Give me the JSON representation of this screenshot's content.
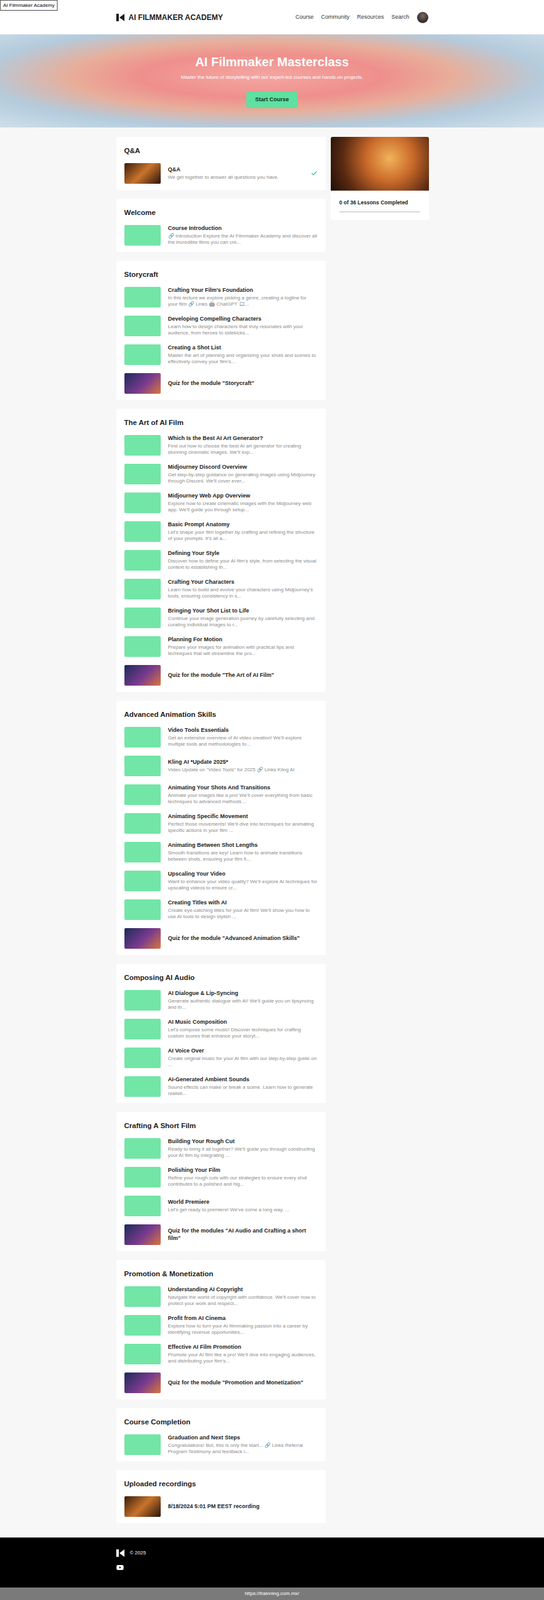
{
  "skip_link": "AI Filmmaker Academy",
  "header": {
    "brand": "AI FILMMAKER ACADEMY",
    "nav": [
      "Course",
      "Community",
      "Resources",
      "Search"
    ]
  },
  "hero": {
    "title": "AI Filmmaker Masterclass",
    "subtitle": "Master the future of storytelling with our expert-led courses and hands-on projects.",
    "button": "Start Course"
  },
  "modules": [
    {
      "title": "Q&A",
      "items": [
        {
          "title": "Q&A",
          "description": "We get together to answer all questions you have.",
          "kind": "photo",
          "checked": true
        }
      ]
    },
    {
      "title": "Welcome",
      "items": [
        {
          "title": "Course Introduction",
          "description": "🔗 Introduction Explore the AI Filmmaker Academy and discover all the incredible films you can cre...",
          "kind": "lesson",
          "checked": false
        }
      ]
    },
    {
      "title": "Storycraft",
      "items": [
        {
          "title": "Crafting Your Film's Foundation",
          "description": "In this lecture we explore picking a genre, creating a logline for your film 🔗 Links 🤖 ChatGPT 🎞...",
          "kind": "lesson",
          "checked": false
        },
        {
          "title": "Developing Compelling Characters",
          "description": "Learn how to design characters that truly resonates with your audience, from heroes to sidekicks...",
          "kind": "lesson",
          "checked": false
        },
        {
          "title": "Creating a Shot List",
          "description": "Master the art of planning and organizing your shots and scenes to effectively convey your film's...",
          "kind": "lesson",
          "checked": false
        },
        {
          "title": "Quiz for the module \"Storycraft\"",
          "description": "",
          "kind": "quiz",
          "checked": false
        }
      ]
    },
    {
      "title": "The Art of AI Film",
      "items": [
        {
          "title": "Which Is the Best AI Art Generator?",
          "description": "Find out how to choose the best AI art generator for creating stunning cinematic images. We'll exp...",
          "kind": "lesson",
          "checked": false
        },
        {
          "title": "Midjourney Discord Overview",
          "description": "Get step-by-step guidance on generating images using Midjourney through Discord. We'll cover ever...",
          "kind": "lesson",
          "checked": false
        },
        {
          "title": "Midjourney Web App Overview",
          "description": "Explore how to create cinematic images with the Midjourney web app. We'll guide you through setup...",
          "kind": "lesson",
          "checked": false
        },
        {
          "title": "Basic Prompt Anatomy",
          "description": "Let's shape your film together by crafting and refining the structure of your prompts. It's all a...",
          "kind": "lesson",
          "checked": false
        },
        {
          "title": "Defining Your Style",
          "description": "Discover how to define your AI film's style, from selecting the visual context to establishing th...",
          "kind": "lesson",
          "checked": false
        },
        {
          "title": "Crafting Your Characters",
          "description": "Learn how to build and evolve your characters using Midjourney's tools, ensuring consistency in s...",
          "kind": "lesson",
          "checked": false
        },
        {
          "title": "Bringing Your Shot List to Life",
          "description": "Continue your image generation journey by carefully selecting and curating individual images to r...",
          "kind": "lesson",
          "checked": false
        },
        {
          "title": "Planning For Motion",
          "description": "Prepare your images for animation with practical tips and techniques that will streamline the pro...",
          "kind": "lesson",
          "checked": false
        },
        {
          "title": "Quiz for the module \"The Art of AI Film\"",
          "description": "",
          "kind": "quiz",
          "checked": false
        }
      ]
    },
    {
      "title": "Advanced Animation Skills",
      "items": [
        {
          "title": "Video Tools Essentials",
          "description": "Get an extensive overview of AI video creation! We'll explore multiple tools and methodologies to...",
          "kind": "lesson",
          "checked": false
        },
        {
          "title": "Kling AI *Update 2025*",
          "description": "Video Update on \"Video Tools\" for 2025 🔗 Links Kling AI",
          "kind": "lesson",
          "checked": false
        },
        {
          "title": "Animating Your Shots And Transitions",
          "description": "Animate your images like a pro! We'll cover everything from basic techniques to advanced methods ...",
          "kind": "lesson",
          "checked": false
        },
        {
          "title": "Animating Specific Movement",
          "description": "Perfect those movements! We'll dive into techniques for animating specific actions in your film ...",
          "kind": "lesson",
          "checked": false
        },
        {
          "title": "Animating Between Shot Lengths",
          "description": "Smooth transitions are key! Learn how to animate transitions between shots, ensuring your film fl...",
          "kind": "lesson",
          "checked": false
        },
        {
          "title": "Upscaling Your Video",
          "description": "Want to enhance your video quality? We'll explore AI techniques for upscaling videos to ensure cr...",
          "kind": "lesson",
          "checked": false
        },
        {
          "title": "Creating Titles with AI",
          "description": "Create eye-catching titles for your AI film! We'll show you how to use AI tools to design stylish ...",
          "kind": "lesson",
          "checked": false
        },
        {
          "title": "Quiz for the module \"Advanced Animation Skills\"",
          "description": "",
          "kind": "quiz",
          "checked": false
        }
      ]
    },
    {
      "title": "Composing AI Audio",
      "items": [
        {
          "title": "AI Dialogue & Lip-Syncing",
          "description": "Generate authentic dialogue with AI! We'll guide you on lipsyncing and th...",
          "kind": "lesson",
          "checked": false
        },
        {
          "title": "AI Music Composition",
          "description": "Let's compose some music! Discover techniques for crafting custom scores that enhance your storyt...",
          "kind": "lesson",
          "checked": false
        },
        {
          "title": "AI Voice Over",
          "description": "Create original music for your AI film with our step-by-step guide on ...",
          "kind": "lesson",
          "checked": false
        },
        {
          "title": "AI-Generated Ambient Sounds",
          "description": "Sound effects can make or break a scene. Learn how to generate realisti...",
          "kind": "lesson",
          "checked": false
        }
      ]
    },
    {
      "title": "Crafting A Short Film",
      "items": [
        {
          "title": "Building Your Rough Cut",
          "description": "Ready to bring it all together? We'll guide you through constructing your AI film by integrating ...",
          "kind": "lesson",
          "checked": false
        },
        {
          "title": "Polishing Your Film",
          "description": "Refine your rough cuts with our strategies to ensure every shot contributes to a polished and hig...",
          "kind": "lesson",
          "checked": false
        },
        {
          "title": "World Premiere",
          "description": "Let's get ready to premiere! We've come a long way. ...",
          "kind": "lesson",
          "checked": false
        },
        {
          "title": "Quiz for the modules \"AI Audio and Crafting a short film\"",
          "description": "",
          "kind": "quiz",
          "checked": false
        }
      ]
    },
    {
      "title": "Promotion & Monetization",
      "items": [
        {
          "title": "Understanding AI Copyright",
          "description": "Navigate the world of copyright with confidence. We'll cover how to protect your work and respect...",
          "kind": "lesson",
          "checked": false
        },
        {
          "title": "Profit from AI Cinema",
          "description": "Explore how to turn your AI filmmaking passion into a career by identifying revenue opportunities...",
          "kind": "lesson",
          "checked": false
        },
        {
          "title": "Effective AI Film Promotion",
          "description": "Promote your AI film like a pro! We'll dive into engaging audiences, and distributing your film's...",
          "kind": "lesson",
          "checked": false
        },
        {
          "title": "Quiz for the module \"Promotion and Monetization\"",
          "description": "",
          "kind": "quiz",
          "checked": false
        }
      ]
    },
    {
      "title": "Course Completion",
      "items": [
        {
          "title": "Graduation and Next Steps",
          "description": "Congratulations! But, this is only the start... 🔗 Links Referral Program Testimony and feedback i...",
          "kind": "lesson",
          "checked": false
        }
      ]
    },
    {
      "title": "Uploaded recordings",
      "items": [
        {
          "title": "8/18/2024 5:01 PM EEST recording",
          "description": "",
          "kind": "photo",
          "checked": false
        }
      ]
    }
  ],
  "sidebar": {
    "progress_text": "0 of 36 Lessons Completed",
    "level": 0
  },
  "footer": {
    "copyright": "© 2025"
  },
  "status_bar": {
    "url": "https://trainning.com.mx/"
  }
}
